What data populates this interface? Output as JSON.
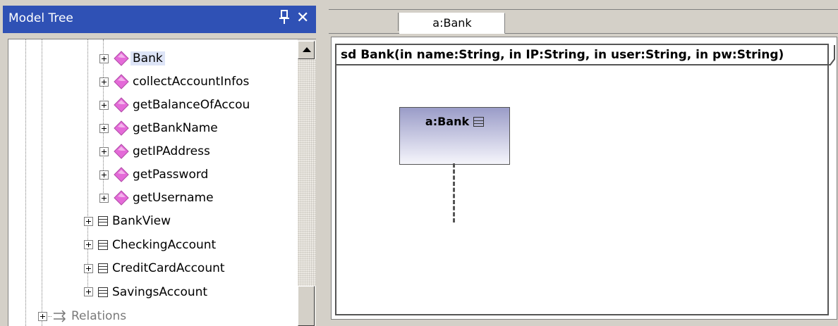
{
  "model_tree": {
    "title": "Model Tree",
    "pin_icon": "pin-icon",
    "close_glyph": "✕",
    "items": [
      {
        "label": "Bank",
        "icon": "operation-icon",
        "selected": true
      },
      {
        "label": "collectAccountInfos",
        "icon": "operation-icon"
      },
      {
        "label": "getBalanceOfAccou",
        "icon": "operation-icon"
      },
      {
        "label": "getBankName",
        "icon": "operation-icon"
      },
      {
        "label": "getIPAddress",
        "icon": "operation-icon"
      },
      {
        "label": "getPassword",
        "icon": "operation-icon"
      },
      {
        "label": "getUsername",
        "icon": "operation-icon"
      },
      {
        "label": "BankView",
        "icon": "class-icon"
      },
      {
        "label": "CheckingAccount",
        "icon": "class-icon"
      },
      {
        "label": "CreditCardAccount",
        "icon": "class-icon"
      },
      {
        "label": "SavingsAccount",
        "icon": "class-icon"
      },
      {
        "label": "Relations",
        "icon": "relations-icon"
      }
    ]
  },
  "diagram": {
    "tab_label": "a:Bank",
    "frame_title": "sd Bank(in name:String, in IP:String, in user:String, in pw:String)",
    "lifeline_label": "a:Bank"
  },
  "colors": {
    "title_bar": "#2f51b5",
    "operation_icon": "#e46ad8",
    "selection": "#dde4f7",
    "lifeline_top": "#9a9cc8"
  }
}
